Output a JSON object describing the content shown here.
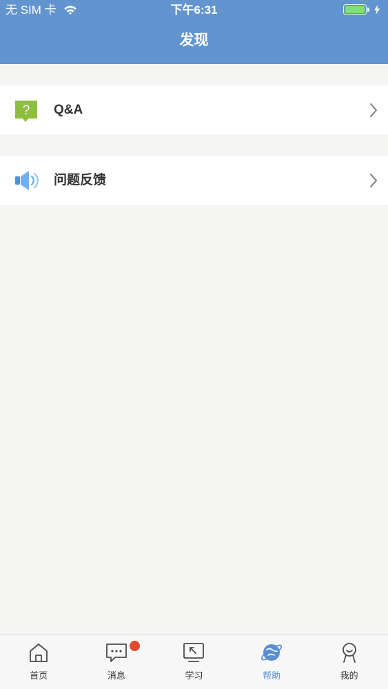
{
  "status_bar": {
    "carrier": "无 SIM 卡",
    "time": "下午6:31",
    "wifi_icon": "wifi-icon",
    "battery_icon": "battery-icon",
    "charging_icon": "bolt-icon"
  },
  "nav": {
    "title": "发现"
  },
  "menu": {
    "items": [
      {
        "label": "Q&A",
        "icon": "question-bubble-icon",
        "icon_color": "#8dbf3f"
      },
      {
        "label": "问题反馈",
        "icon": "speaker-icon",
        "icon_color": "#4a90e2"
      }
    ]
  },
  "tabbar": {
    "active_color": "#5b8fd0",
    "badge_color": "#e14b2d",
    "tabs": [
      {
        "label": "首页",
        "icon": "home-icon"
      },
      {
        "label": "消息",
        "icon": "chat-icon",
        "has_badge": true
      },
      {
        "label": "学习",
        "icon": "learn-screen-icon"
      },
      {
        "label": "帮助",
        "icon": "planet-icon",
        "active": true
      },
      {
        "label": "我的",
        "icon": "user-icon"
      }
    ]
  },
  "colors": {
    "header_bg": "#6295cf",
    "page_bg": "#f5f5f4"
  }
}
